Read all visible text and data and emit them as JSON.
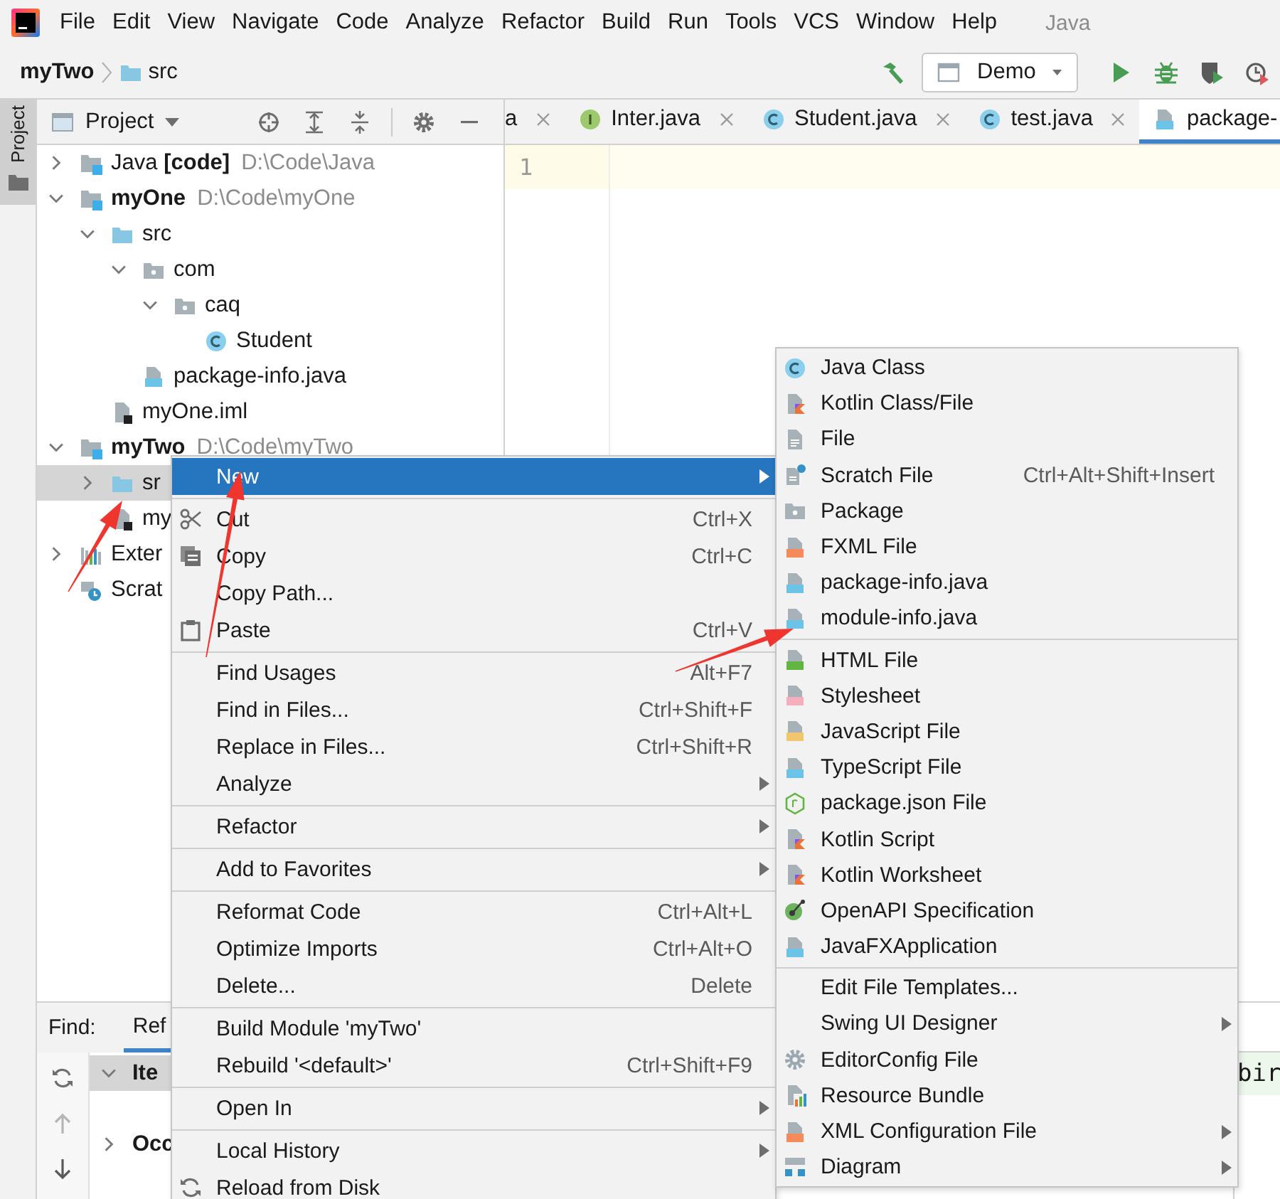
{
  "menubar": {
    "items": [
      {
        "label": "File"
      },
      {
        "label": "Edit"
      },
      {
        "label": "View"
      },
      {
        "label": "Navigate"
      },
      {
        "label": "Code"
      },
      {
        "label": "Analyze"
      },
      {
        "label": "Refactor"
      },
      {
        "label": "Build"
      },
      {
        "label": "Run"
      },
      {
        "label": "Tools"
      },
      {
        "label": "VCS"
      },
      {
        "label": "Window"
      },
      {
        "label": "Help"
      }
    ],
    "title": "Java"
  },
  "navbar": {
    "breadcrumbs": [
      {
        "label": "myTwo",
        "bold": true
      },
      {
        "label": "src",
        "kind": "source-folder",
        "bold": false
      }
    ],
    "run_config": "Demo"
  },
  "tool_strip": {
    "tabs": [
      {
        "label": "Project",
        "selected": true
      }
    ]
  },
  "project_panel": {
    "title": "Project",
    "tree": [
      {
        "label": "Java **[code]**",
        "detail": "D:\\Code\\Java",
        "kind": "module",
        "expanded": false,
        "selected": false
      },
      {
        "label": "myOne",
        "bold": true,
        "detail": "D:\\Code\\myOne",
        "kind": "module",
        "expanded": true,
        "selected": false,
        "children": [
          {
            "label": "src",
            "kind": "source-folder",
            "expanded": true,
            "selected": false,
            "children": [
              {
                "label": "com",
                "kind": "package",
                "expanded": true,
                "selected": false,
                "children": [
                  {
                    "label": "caq",
                    "kind": "package",
                    "expanded": true,
                    "selected": false,
                    "children": [
                      {
                        "label": "Student",
                        "kind": "class",
                        "selected": false
                      }
                    ]
                  }
                ]
              },
              {
                "label": "package-info.java",
                "kind": "java-file",
                "selected": false
              }
            ]
          },
          {
            "label": "myOne.iml",
            "kind": "iml",
            "selected": false
          }
        ]
      },
      {
        "label": "myTwo",
        "bold": true,
        "detail": "D:\\Code\\myTwo",
        "kind": "module",
        "expanded": true,
        "selected": false,
        "children": [
          {
            "label": "sr",
            "kind": "source-folder",
            "expanded": false,
            "selected": true
          },
          {
            "label": "my",
            "kind": "iml",
            "selected": false
          }
        ]
      },
      {
        "label": "Exter",
        "kind": "library",
        "expanded": false,
        "selected": false
      },
      {
        "label": "Scrat",
        "kind": "scratches",
        "selected": false
      }
    ]
  },
  "editor": {
    "tabs": [
      {
        "label": "a",
        "closable": true,
        "selected": false
      },
      {
        "label": "Inter.java",
        "kind": "interface",
        "closable": true,
        "selected": false
      },
      {
        "label": "Student.java",
        "kind": "class",
        "closable": true,
        "selected": false
      },
      {
        "label": "test.java",
        "kind": "class",
        "closable": true,
        "selected": false
      },
      {
        "label": "package-",
        "kind": "java-file",
        "closable": false,
        "selected": true
      }
    ],
    "line_numbers": [
      "1"
    ]
  },
  "find_panel": {
    "label": "Find:",
    "tabs": [
      {
        "label": "Ref",
        "selected": true
      }
    ],
    "tree": [
      {
        "label": "Ite",
        "expanded": true,
        "selected": true
      },
      {
        "label": "Occ",
        "expanded": false,
        "selected": false
      }
    ],
    "preview": "bir"
  },
  "context_menu": {
    "groups": [
      [
        {
          "label": "New",
          "submenu": true,
          "selected": true
        }
      ],
      [
        {
          "label": "Cut",
          "kind": "scissors",
          "shortcut": "Ctrl+X",
          "submenu": false,
          "selected": false
        },
        {
          "label": "Copy",
          "kind": "copy",
          "shortcut": "Ctrl+C",
          "submenu": false,
          "selected": false
        },
        {
          "label": "Copy Path...",
          "submenu": false,
          "selected": false
        },
        {
          "label": "Paste",
          "kind": "paste",
          "shortcut": "Ctrl+V",
          "submenu": false,
          "selected": false
        }
      ],
      [
        {
          "label": "Find Usages",
          "shortcut": "Alt+F7",
          "submenu": false,
          "selected": false
        },
        {
          "label": "Find in Files...",
          "shortcut": "Ctrl+Shift+F",
          "submenu": false,
          "selected": false
        },
        {
          "label": "Replace in Files...",
          "shortcut": "Ctrl+Shift+R",
          "submenu": false,
          "selected": false
        },
        {
          "label": "Analyze",
          "submenu": true,
          "selected": false
        }
      ],
      [
        {
          "label": "Refactor",
          "submenu": true,
          "selected": false
        }
      ],
      [
        {
          "label": "Add to Favorites",
          "submenu": true,
          "selected": false
        }
      ],
      [
        {
          "label": "Reformat Code",
          "shortcut": "Ctrl+Alt+L",
          "submenu": false,
          "selected": false
        },
        {
          "label": "Optimize Imports",
          "shortcut": "Ctrl+Alt+O",
          "submenu": false,
          "selected": false
        },
        {
          "label": "Delete...",
          "shortcut": "Delete",
          "submenu": false,
          "selected": false
        }
      ],
      [
        {
          "label": "Build Module 'myTwo'",
          "submenu": false,
          "selected": false
        },
        {
          "label": "Rebuild '<default>'",
          "shortcut": "Ctrl+Shift+F9",
          "submenu": false,
          "selected": false
        }
      ],
      [
        {
          "label": "Open In",
          "submenu": true,
          "selected": false
        }
      ],
      [
        {
          "label": "Local History",
          "submenu": true,
          "selected": false
        },
        {
          "label": "Reload from Disk",
          "kind": "reload",
          "submenu": false,
          "selected": false
        }
      ]
    ]
  },
  "new_submenu": {
    "groups": [
      [
        {
          "label": "Java Class",
          "kind": "class",
          "submenu": false,
          "selected": false
        },
        {
          "label": "Kotlin Class/File",
          "kind": "kotlin",
          "submenu": false,
          "selected": false
        },
        {
          "label": "File",
          "kind": "file",
          "submenu": false,
          "selected": false
        },
        {
          "label": "Scratch File",
          "kind": "scratch",
          "shortcut": "Ctrl+Alt+Shift+Insert",
          "submenu": false,
          "selected": false
        },
        {
          "label": "Package",
          "kind": "package",
          "submenu": false,
          "selected": false
        },
        {
          "label": "FXML File",
          "kind": "fxml",
          "submenu": false,
          "selected": false
        },
        {
          "label": "package-info.java",
          "kind": "java-file",
          "submenu": false,
          "selected": false
        },
        {
          "label": "module-info.java",
          "kind": "java-file",
          "submenu": false,
          "selected": false
        }
      ],
      [
        {
          "label": "HTML File",
          "kind": "html",
          "submenu": false,
          "selected": false
        },
        {
          "label": "Stylesheet",
          "kind": "css",
          "submenu": false,
          "selected": false
        },
        {
          "label": "JavaScript File",
          "kind": "js",
          "submenu": false,
          "selected": false
        },
        {
          "label": "TypeScript File",
          "kind": "ts",
          "submenu": false,
          "selected": false
        },
        {
          "label": "package.json File",
          "kind": "nodejs",
          "submenu": false,
          "selected": false
        },
        {
          "label": "Kotlin Script",
          "kind": "kotlin",
          "submenu": false,
          "selected": false
        },
        {
          "label": "Kotlin Worksheet",
          "kind": "kotlin",
          "submenu": false,
          "selected": false
        },
        {
          "label": "OpenAPI Specification",
          "kind": "openapi",
          "submenu": false,
          "selected": false
        },
        {
          "label": "JavaFXApplication",
          "kind": "java-file",
          "submenu": false,
          "selected": false
        }
      ],
      [
        {
          "label": "Edit File Templates...",
          "submenu": false,
          "selected": false
        },
        {
          "label": "Swing UI Designer",
          "submenu": true,
          "selected": false
        },
        {
          "label": "EditorConfig File",
          "kind": "gear",
          "submenu": false,
          "selected": false
        },
        {
          "label": "Resource Bundle",
          "kind": "resource",
          "submenu": false,
          "selected": false
        },
        {
          "label": "XML Configuration File",
          "kind": "xml",
          "submenu": true,
          "selected": false
        },
        {
          "label": "Diagram",
          "kind": "diagram",
          "submenu": true,
          "selected": false
        }
      ]
    ]
  }
}
